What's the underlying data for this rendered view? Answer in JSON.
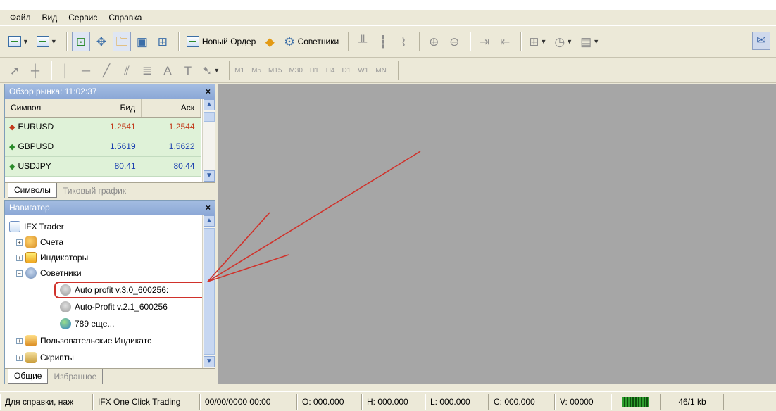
{
  "menu": [
    "Файл",
    "Вид",
    "Сервис",
    "Справка"
  ],
  "toolbar": {
    "new_order_label": "Новый Ордер",
    "advisors_label": "Советники",
    "timeframes": [
      "M1",
      "M5",
      "M15",
      "M30",
      "H1",
      "H4",
      "D1",
      "W1",
      "MN"
    ]
  },
  "market_watch": {
    "title": "Обзор рынка: 11:02:37",
    "columns": [
      "Символ",
      "Бид",
      "Аск"
    ],
    "rows": [
      {
        "symbol": "EURUSD",
        "bid": "1.2541",
        "ask": "1.2544",
        "trend": "down",
        "color": "#c23a1b"
      },
      {
        "symbol": "GBPUSD",
        "bid": "1.5619",
        "ask": "1.5622",
        "trend": "up",
        "color": "#1b3fb0"
      },
      {
        "symbol": "USDJPY",
        "bid": "80.41",
        "ask": "80.44",
        "trend": "up",
        "color": "#1b3fb0"
      }
    ],
    "tabs": [
      "Символы",
      "Тиковый график"
    ]
  },
  "navigator": {
    "title": "Навигатор",
    "items": {
      "root": "IFX Trader",
      "accounts": "Счета",
      "indicators": "Индикаторы",
      "advisors": "Советники",
      "adv1": "Auto profit v.3.0_600256:",
      "adv2": "Auto-Profit v.2.1_600256",
      "more": "789 еще...",
      "custom": "Пользовательские Индикатс",
      "scripts": "Скрипты"
    },
    "tabs": [
      "Общие",
      "Избранное"
    ]
  },
  "statusbar": {
    "help": "Для справки, наж",
    "profile": "IFX One Click Trading",
    "datetime": "00/00/0000 00:00",
    "open": "O: 000.000",
    "high": "H: 000.000",
    "low": "L: 000.000",
    "close": "C: 000.000",
    "volume": "V: 00000",
    "traffic": "46/1 kb"
  },
  "colors": {
    "highlight": "#d0322b",
    "chart_bg": "#a6a6a6",
    "panel_title": "#8ca8d6"
  }
}
